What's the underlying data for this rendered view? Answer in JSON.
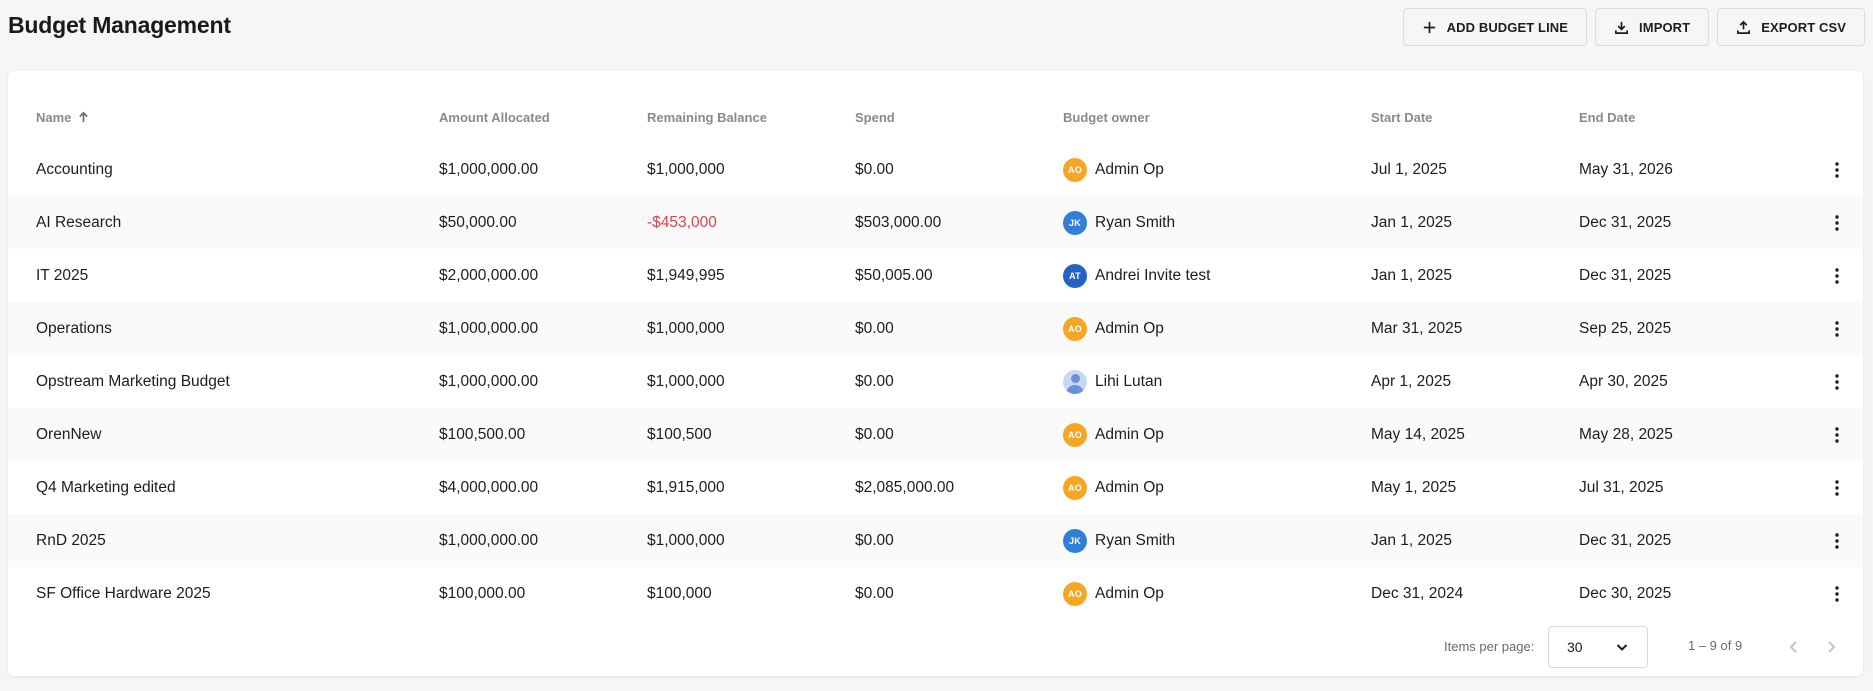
{
  "page": {
    "title": "Budget Management"
  },
  "actions": {
    "add_label": "ADD BUDGET LINE",
    "import_label": "IMPORT",
    "export_label": "EXPORT CSV"
  },
  "table": {
    "columns": [
      "Name",
      "Amount Allocated",
      "Remaining Balance",
      "Spend",
      "Budget owner",
      "Start Date",
      "End Date"
    ],
    "sort": {
      "column": "Name",
      "direction": "ascending"
    },
    "rows": [
      {
        "name": "Accounting",
        "allocated": "$1,000,000.00",
        "remaining": "$1,000,000",
        "remaining_negative": false,
        "spend": "$0.00",
        "owner_initials": "AO",
        "owner_avatar": "initials",
        "owner_color": "#f5a623",
        "owner": "Admin Op",
        "start": "Jul 1, 2025",
        "end": "May 31, 2026"
      },
      {
        "name": "AI Research",
        "allocated": "$50,000.00",
        "remaining": "-$453,000",
        "remaining_negative": true,
        "spend": "$503,000.00",
        "owner_initials": "JK",
        "owner_avatar": "initials",
        "owner_color": "#2f7fd8",
        "owner": "Ryan Smith",
        "start": "Jan 1, 2025",
        "end": "Dec 31, 2025"
      },
      {
        "name": "IT 2025",
        "allocated": "$2,000,000.00",
        "remaining": "$1,949,995",
        "remaining_negative": false,
        "spend": "$50,005.00",
        "owner_initials": "AT",
        "owner_avatar": "initials",
        "owner_color": "#2363c6",
        "owner": "Andrei Invite test",
        "start": "Jan 1, 2025",
        "end": "Dec 31, 2025"
      },
      {
        "name": "Operations",
        "allocated": "$1,000,000.00",
        "remaining": "$1,000,000",
        "remaining_negative": false,
        "spend": "$0.00",
        "owner_initials": "AO",
        "owner_avatar": "initials",
        "owner_color": "#f5a623",
        "owner": "Admin Op",
        "start": "Mar 31, 2025",
        "end": "Sep 25, 2025"
      },
      {
        "name": "Opstream Marketing Budget",
        "allocated": "$1,000,000.00",
        "remaining": "$1,000,000",
        "remaining_negative": false,
        "spend": "$0.00",
        "owner_initials": "",
        "owner_avatar": "photo",
        "owner_color": "#c7d8f5",
        "owner": "Lihi Lutan",
        "start": "Apr 1, 2025",
        "end": "Apr 30, 2025"
      },
      {
        "name": "OrenNew",
        "allocated": "$100,500.00",
        "remaining": "$100,500",
        "remaining_negative": false,
        "spend": "$0.00",
        "owner_initials": "AO",
        "owner_avatar": "initials",
        "owner_color": "#f5a623",
        "owner": "Admin Op",
        "start": "May 14, 2025",
        "end": "May 28, 2025"
      },
      {
        "name": "Q4 Marketing edited",
        "allocated": "$4,000,000.00",
        "remaining": "$1,915,000",
        "remaining_negative": false,
        "spend": "$2,085,000.00",
        "owner_initials": "AO",
        "owner_avatar": "initials",
        "owner_color": "#f5a623",
        "owner": "Admin Op",
        "start": "May 1, 2025",
        "end": "Jul 31, 2025"
      },
      {
        "name": "RnD 2025",
        "allocated": "$1,000,000.00",
        "remaining": "$1,000,000",
        "remaining_negative": false,
        "spend": "$0.00",
        "owner_initials": "JK",
        "owner_avatar": "initials",
        "owner_color": "#2f7fd8",
        "owner": "Ryan Smith",
        "start": "Jan 1, 2025",
        "end": "Dec 31, 2025"
      },
      {
        "name": "SF Office Hardware 2025",
        "allocated": "$100,000.00",
        "remaining": "$100,000",
        "remaining_negative": false,
        "spend": "$0.00",
        "owner_initials": "AO",
        "owner_avatar": "initials",
        "owner_color": "#f5a623",
        "owner": "Admin Op",
        "start": "Dec 31, 2024",
        "end": "Dec 30, 2025"
      }
    ]
  },
  "pagination": {
    "items_per_page_label": "Items per page:",
    "items_per_page": "30",
    "range_label": "1 – 9 of 9"
  },
  "colors": {
    "negative": "#e0424a",
    "page_bg": "#f6f6f6"
  }
}
